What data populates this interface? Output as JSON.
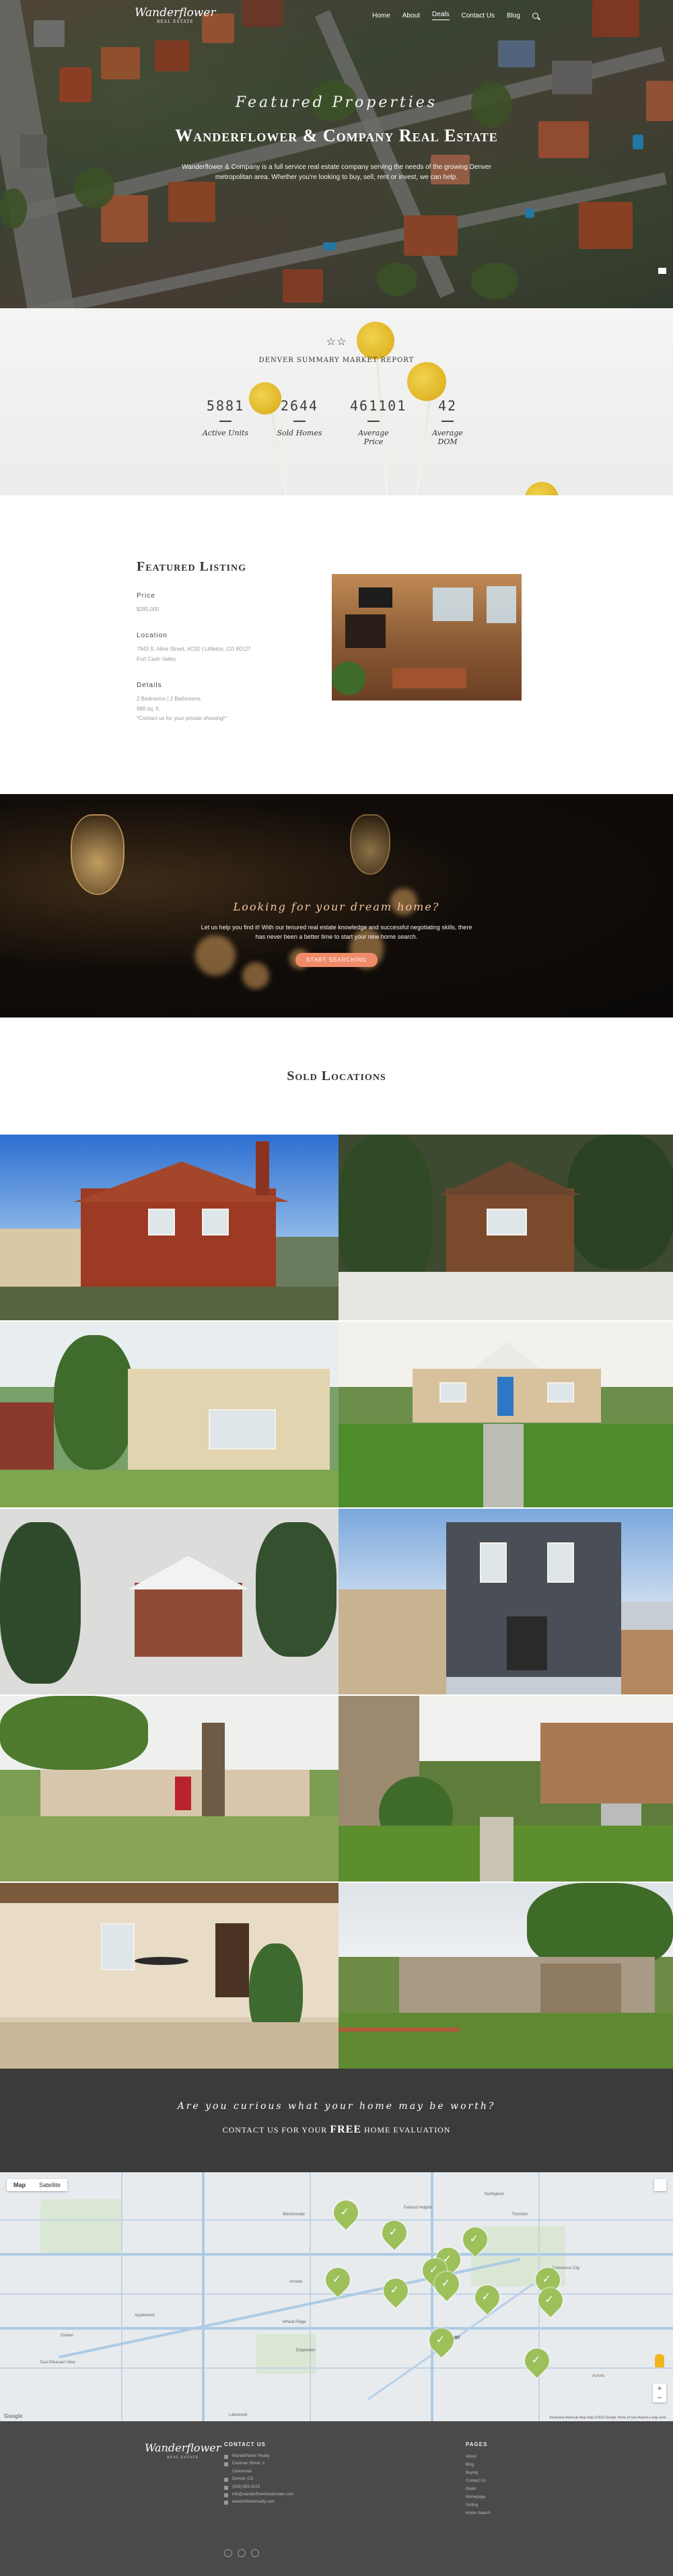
{
  "nav": {
    "logo": "Wanderflower",
    "logo_sub": "REAL ESTATE",
    "items": [
      "Home",
      "About",
      "Deals",
      "Contact Us",
      "Blog"
    ],
    "active": "Deals"
  },
  "hero": {
    "kicker": "Featured Properties",
    "title": "Wanderflower & Company Real Estate",
    "description": "Wanderflower & Company is a full service real estate company serving the needs of the growing Denver metropolitan area. Whether you're looking to buy, sell, rent or invest, we can help."
  },
  "stats": {
    "stars": "☆☆",
    "heading": "Denver Summary Market Report",
    "items": [
      {
        "value": "5881",
        "label": "Active Units"
      },
      {
        "value": "2644",
        "label": "Sold Homes"
      },
      {
        "value": "461101",
        "label": "Average Price"
      },
      {
        "value": "42",
        "label": "Average DOM"
      }
    ]
  },
  "featured": {
    "title": "Featured Listing",
    "price_label": "Price",
    "price_value": "$285,000",
    "location_label": "Location",
    "location_line1": "7943 S. Aline Street, #C02 | Littleton, CO 80127",
    "location_line2": "Fort Cash Valley",
    "details_label": "Details",
    "details_line1": "2 Bedrooms | 2 Bathrooms",
    "details_line2": "980 sq. ft.",
    "details_line3": "*Contact us for your private showing!*"
  },
  "dream": {
    "title": "Looking for your dream home?",
    "description": "Let us help you find it! With our tenured real estate knowledge and successful negotiating skills, there has never been a better time to start your new home search.",
    "button": "Start Searching"
  },
  "sold": {
    "title": "Sold Locations"
  },
  "cta": {
    "line1": "Are you curious what your home may be worth?",
    "line2_pre": "Contact us for your",
    "line2_free": "FREE",
    "line2_post": "home evaluation"
  },
  "map": {
    "map_button": "Map",
    "satellite_button": "Satellite",
    "labels": [
      "Westminster",
      "Federal Heights",
      "Thornton",
      "Northglenn",
      "Arvada",
      "Wheat Ridge",
      "Edgewater",
      "Denver",
      "Lakewood",
      "Golden",
      "Aurora",
      "Commerce City",
      "East Pleasant View",
      "Applewood"
    ],
    "footer": "Keyboard shortcuts   Map data ©2022 Google   Terms of Use   Report a map error",
    "logo": "Google"
  },
  "footer": {
    "logo": "Wanderflower",
    "logo_sub": "REAL ESTATE",
    "contact_heading": "CONTACT US",
    "contact_lines": [
      "Wanderflower Realty",
      "Eastman Street, #",
      "Centennial",
      "Denver, CO",
      "(303) 555-0123",
      "info@wanderflowerrealestate.com",
      "wanderflowerrealty.com"
    ],
    "pages_heading": "PAGES",
    "pages": [
      "About",
      "Blog",
      "Buying",
      "Contact Us",
      "Deals",
      "Homepage",
      "Selling",
      "Home Search"
    ]
  },
  "colors": {
    "accent": "#f08b6a",
    "pin": "#9dc05a",
    "footer_bg": "#4a4a4a",
    "cta_bg": "#3b3b3b"
  }
}
